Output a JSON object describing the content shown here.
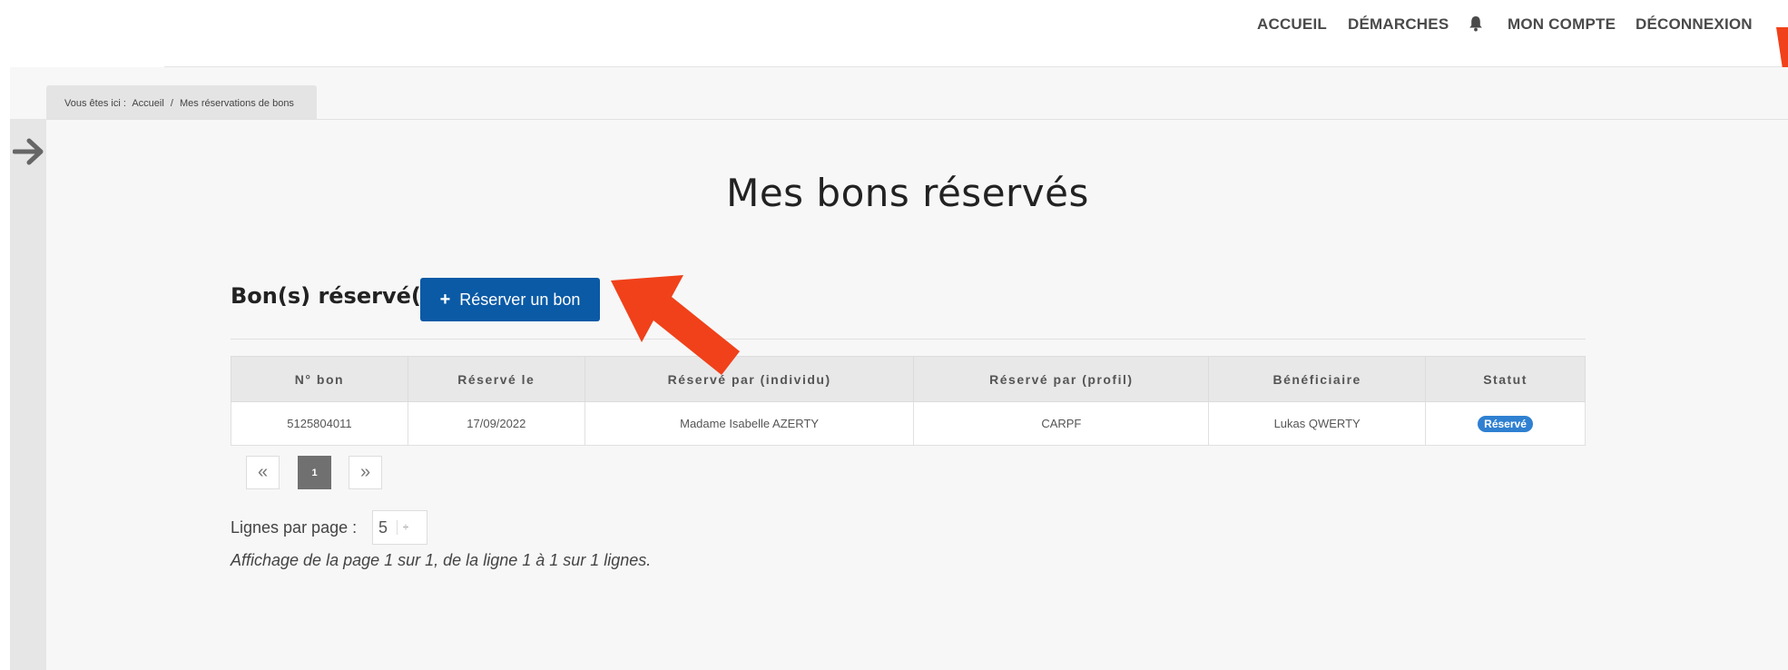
{
  "nav": {
    "home": "ACCUEIL",
    "procedures": "DÉMARCHES",
    "account": "MON COMPTE",
    "logout": "DÉCONNEXION",
    "bell_icon": "bell-icon"
  },
  "breadcrumb": {
    "prefix": "Vous êtes ici :",
    "home": "Accueil",
    "separator": "/",
    "current": "Mes réservations de bons"
  },
  "page": {
    "title": "Mes bons réservés",
    "section_title": "Bon(s) réservé(s)",
    "add_button_icon": "+",
    "add_button_label": "Réserver un bon"
  },
  "table": {
    "headers": [
      "N° bon",
      "Réservé le",
      "Réservé par (individu)",
      "Réservé par (profil)",
      "Bénéficiaire",
      "Statut"
    ],
    "rows": [
      {
        "numero": "5125804011",
        "date": "17/09/2022",
        "individu": "Madame Isabelle AZERTY",
        "profil": "CARPF",
        "beneficiaire": "Lukas QWERTY",
        "statut": "Réservé"
      }
    ]
  },
  "pagination": {
    "prev": "«",
    "current": "1",
    "next": "»"
  },
  "rows_per_page": {
    "label": "Lignes par page :",
    "value": "5",
    "arrow": "÷"
  },
  "info": "Affichage de la page 1 sur 1, de la ligne 1 à 1 sur 1 lignes.",
  "colors": {
    "primary_button": "#0a5aa6",
    "status_badge": "#2f80d1",
    "annotation_arrow": "#f0411a"
  }
}
